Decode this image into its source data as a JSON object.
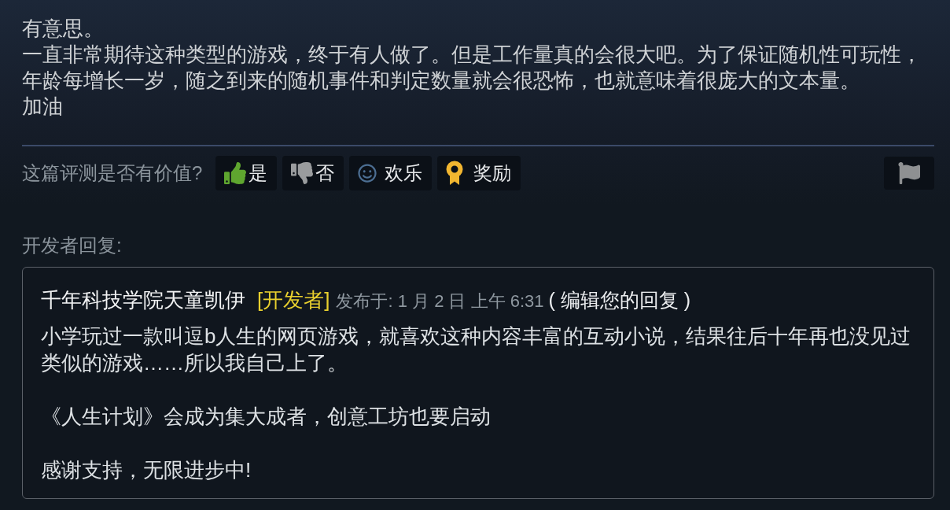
{
  "review": {
    "paragraphs": [
      "有意思。",
      "一直非常期待这种类型的游戏，终于有人做了。但是工作量真的会很大吧。为了保证随机性可玩性，年龄每增长一岁，随之到来的随机事件和判定数量就会很恐怖，也就意味着很庞大的文本量。",
      "加油"
    ]
  },
  "helpful_prompt": {
    "label": "这篇评测是否有价值?",
    "buttons": [
      {
        "kind": "yes",
        "label": "是"
      },
      {
        "kind": "no",
        "label": "否"
      },
      {
        "kind": "funny",
        "label": "欢乐"
      },
      {
        "kind": "award",
        "label": "奖励"
      }
    ]
  },
  "developer_response": {
    "heading": "开发者回复:",
    "author": "千年科技学院天童凯伊",
    "badge": "[开发者]",
    "posted": "发布于: 1 月 2 日 上午 6:31",
    "edit_link": "( 编辑您的回复 )",
    "paragraphs": [
      "小学玩过一款叫逗b人生的网页游戏，就喜欢这种内容丰富的互动小说，结果往后十年再也没见过类似的游戏……所以我自己上了。",
      "《人生计划》会成为集大成者，创意工坊也要启动",
      "感谢支持，无限进步中!"
    ]
  }
}
